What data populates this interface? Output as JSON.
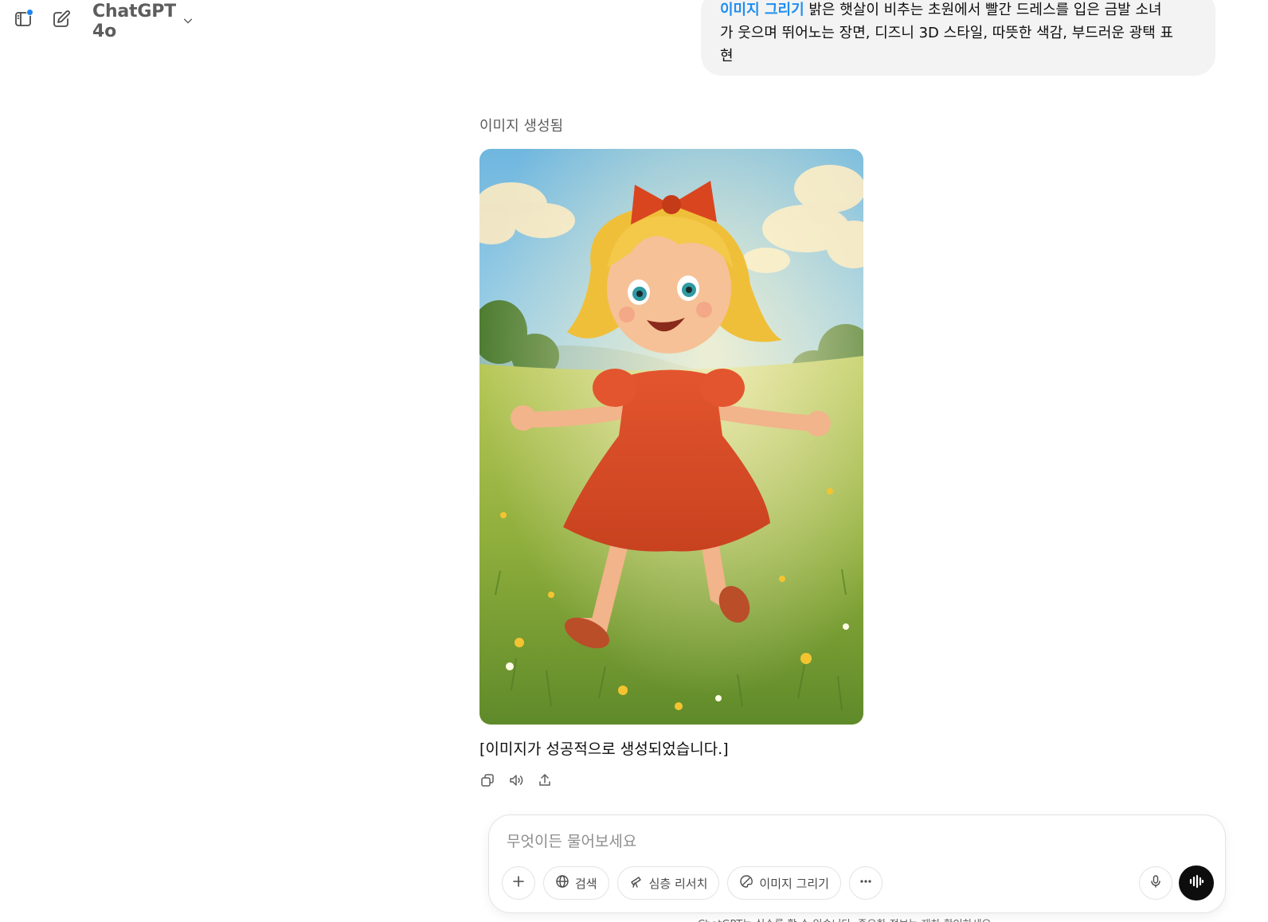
{
  "header": {
    "model_name": "ChatGPT 4o",
    "sidebar_icon": "sidebar-toggle-icon",
    "new_chat_icon": "new-chat-icon",
    "has_notification": true
  },
  "user_message": {
    "tag": "이미지 그리기",
    "line1": "밝은 햇살이 비추는 초원에서 빨간 드레스를 입은 금발 소녀",
    "line2": "가 웃으며 뛰어노는 장면, 디즈니 3D 스타일, 따뜻한 색감, 부드러운 광택 표",
    "line3": "현"
  },
  "assistant": {
    "status_label": "이미지 생성됨",
    "result_text": "[이미지가 성공적으로 생성되었습니다.]",
    "actions": [
      "copy-icon",
      "read-aloud-icon",
      "share-icon"
    ]
  },
  "composer": {
    "placeholder": "무엇이든 물어보세요",
    "tools": {
      "search": "검색",
      "deep_research": "심층 리서치",
      "create_image": "이미지 그리기"
    }
  },
  "footer": {
    "disclaimer": "ChatGPT는 실수를 할 수 있습니다. 중요한 정보는 재차 확인하세요."
  },
  "colors": {
    "accent_blue": "#1d8ef0",
    "bubble_bg": "#f3f3f3",
    "voice_button": "#0d0d0d"
  }
}
